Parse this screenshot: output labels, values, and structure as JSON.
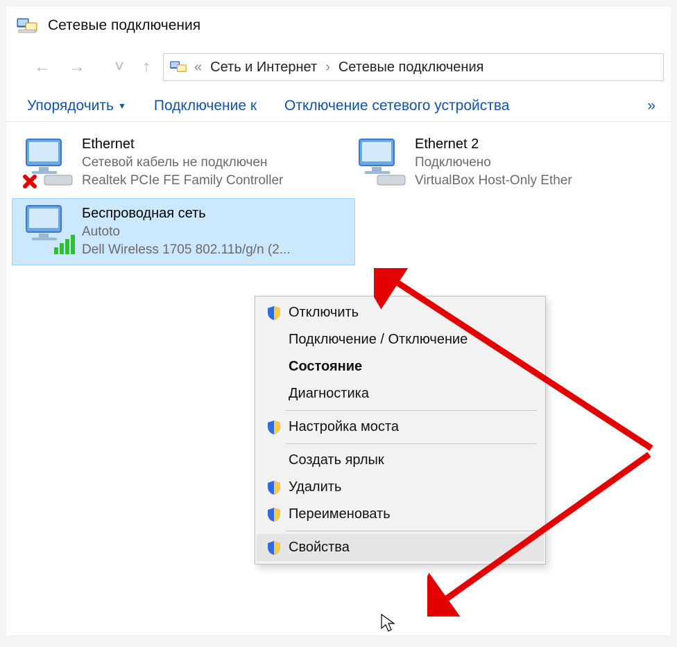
{
  "window": {
    "title": "Сетевые подключения"
  },
  "breadcrumb": {
    "chevrons": "«",
    "p1": "Сеть и Интернет",
    "sep": "›",
    "p2": "Сетевые подключения"
  },
  "toolbar": {
    "organize": "Упорядочить",
    "connect_to": "Подключение к",
    "disable_device": "Отключение сетевого устройства",
    "more": "»"
  },
  "adapters": [
    {
      "name": "Ethernet",
      "status": "Сетевой кабель не подключен",
      "device": "Realtek PCIe FE Family Controller",
      "state": "disconnected"
    },
    {
      "name": "Ethernet 2",
      "status": "Подключено",
      "device": "VirtualBox Host-Only Ether",
      "state": "connected"
    },
    {
      "name": "Беспроводная сеть",
      "status": "Autoto",
      "device": "Dell Wireless 1705 802.11b/g/n (2...",
      "state": "wireless-selected"
    }
  ],
  "context_menu": {
    "disable": "Отключить",
    "connect_disconnect": "Подключение / Отключение",
    "status": "Состояние",
    "diagnose": "Диагностика",
    "bridge": "Настройка моста",
    "shortcut": "Создать ярлык",
    "delete": "Удалить",
    "rename": "Переименовать",
    "properties": "Свойства"
  }
}
